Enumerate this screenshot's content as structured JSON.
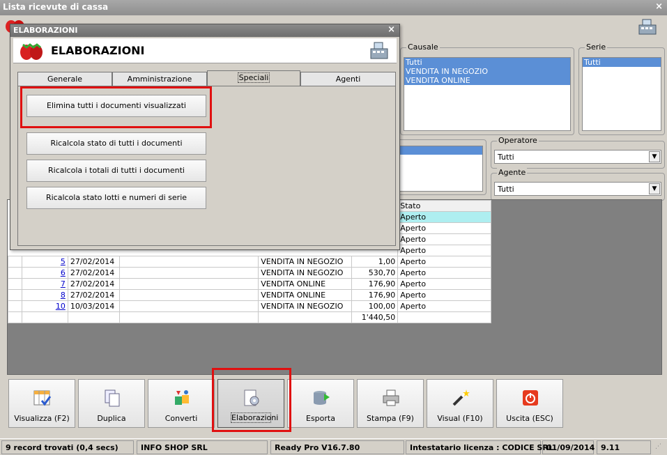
{
  "window": {
    "title": "Lista ricevute di cassa",
    "close": "×"
  },
  "filters": {
    "causale": {
      "label": "Causale",
      "items": [
        "Tutti",
        "VENDITA IN NEGOZIO",
        "VENDITA ONLINE"
      ]
    },
    "serie": {
      "label": "Serie",
      "items": [
        "Tutti"
      ]
    },
    "operatore": {
      "label": "Operatore",
      "value": "Tutti"
    },
    "agente": {
      "label": "Agente",
      "value": "Tutti"
    }
  },
  "grid": {
    "header_stato": "Stato",
    "partial_rows": [
      "Aperto",
      "Aperto",
      "Aperto",
      "Aperto"
    ],
    "rows": [
      {
        "num": "5",
        "date": "27/02/2014",
        "causale": "VENDITA IN NEGOZIO",
        "total": "1,00",
        "stato": "Aperto"
      },
      {
        "num": "6",
        "date": "27/02/2014",
        "causale": "VENDITA IN NEGOZIO",
        "total": "530,70",
        "stato": "Aperto"
      },
      {
        "num": "7",
        "date": "27/02/2014",
        "causale": "VENDITA ONLINE",
        "total": "176,90",
        "stato": "Aperto"
      },
      {
        "num": "8",
        "date": "27/02/2014",
        "causale": "VENDITA ONLINE",
        "total": "176,90",
        "stato": "Aperto"
      },
      {
        "num": "10",
        "date": "10/03/2014",
        "causale": "VENDITA IN NEGOZIO",
        "total": "100,00",
        "stato": "Aperto"
      }
    ],
    "grand_total": "1'440,50"
  },
  "dialog": {
    "title": "ELABORAZIONI",
    "close": "×",
    "header_title": "ELABORAZIONI",
    "tabs": [
      "Generale",
      "Amministrazione",
      "Speciali",
      "Agenti"
    ],
    "active_tab": "Speciali",
    "buttons": [
      "Elimina tutti i documenti visualizzati",
      "Ricalcola stato di tutti i documenti",
      "Ricalcola i totali di tutti i documenti",
      "Ricalcola stato lotti e numeri di serie"
    ]
  },
  "toolbar": {
    "visualizza": "Visualizza (F2)",
    "duplica": "Duplica",
    "converti": "Converti",
    "elaborazioni": "Elaborazioni",
    "esporta": "Esporta",
    "stampa": "Stampa (F9)",
    "visual": "Visual (F10)",
    "uscita": "Uscita (ESC)"
  },
  "status": {
    "records": "9 record trovati (0,4 secs)",
    "company": "INFO SHOP SRL",
    "version": "Ready Pro V16.7.80",
    "license": "Intestatario licenza : CODICE SRL",
    "date": "01/09/2014",
    "build": "9.11"
  },
  "colors": {
    "highlight": "#e01010",
    "selection": "#5b8fd6",
    "active_row": "#aeeef0"
  }
}
